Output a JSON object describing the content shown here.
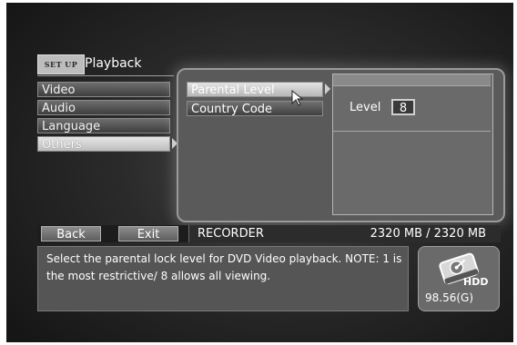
{
  "header": {
    "tag": "SET UP",
    "title": "Playback"
  },
  "main_menu": {
    "items": [
      {
        "label": "Video",
        "selected": false
      },
      {
        "label": "Audio",
        "selected": false
      },
      {
        "label": "Language",
        "selected": false
      },
      {
        "label": "Others",
        "selected": true
      }
    ]
  },
  "sub_menu": {
    "items": [
      {
        "label": "Parental Level",
        "selected": true
      },
      {
        "label": "Country Code",
        "selected": false
      }
    ]
  },
  "value_panel": {
    "label": "Level",
    "value": "8"
  },
  "bottom_bar": {
    "back_label": "Back",
    "exit_label": "Exit",
    "mode": "RECORDER",
    "capacity": "2320 MB / 2320 MB"
  },
  "help": {
    "text": "Select the parental lock level for DVD Video playback. NOTE: 1 is the most restrictive/ 8 allows all viewing."
  },
  "hdd": {
    "label": "HDD",
    "value": "98.56(G)"
  }
}
